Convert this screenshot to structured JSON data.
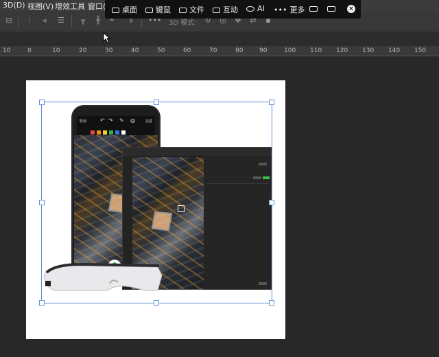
{
  "menubar": {
    "items": [
      "3D(D)",
      "视图(V)",
      "增效工具",
      "窗口(W)"
    ]
  },
  "remote_toolbar": {
    "items": [
      "桌面",
      "键鼠",
      "文件",
      "互动",
      "AI",
      "更多"
    ],
    "close_symbol": "×"
  },
  "options_bar": {
    "mode_label": "3D 模式:"
  },
  "ruler": {
    "ticks": [
      "10",
      "0",
      "10",
      "20",
      "30",
      "40",
      "50",
      "60",
      "70",
      "80",
      "90",
      "100",
      "110",
      "120",
      "130",
      "140",
      "150"
    ]
  },
  "phone": {
    "back_label": "取消",
    "done_label": "完成",
    "swatches": [
      "#e64545",
      "#f08a24",
      "#f2d230",
      "#38b24a",
      "#2f7de1",
      "#ffffff"
    ]
  },
  "colors": {
    "selection": "#5b8fd8",
    "accent_green": "#3cc04a"
  }
}
